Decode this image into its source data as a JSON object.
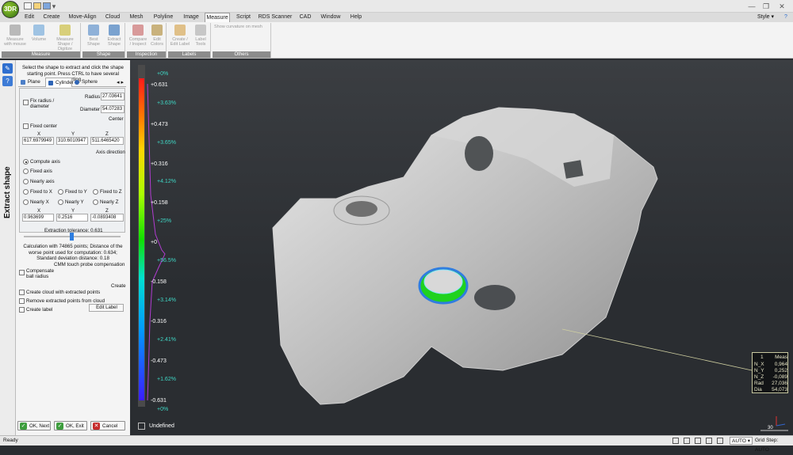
{
  "app": {
    "logo_text": "3DR"
  },
  "menu": {
    "items": [
      "Edit",
      "Create",
      "Move-Align",
      "Cloud",
      "Mesh",
      "Polyline",
      "Image",
      "Measure",
      "Script",
      "RDS Scanner",
      "CAD",
      "Window",
      "Help"
    ],
    "active": "Measure",
    "style_label": "Style"
  },
  "ribbon": {
    "groups": [
      {
        "label": "Measure",
        "buttons": [
          "Measure with mouse",
          "Volume",
          "Measure Shape / Digitize"
        ]
      },
      {
        "label": "Shape",
        "buttons": [
          "Best Shape",
          "Extract Shape"
        ]
      },
      {
        "label": "Inspection",
        "buttons": [
          "Compare / Inspect",
          "Edit Colors"
        ]
      },
      {
        "label": "Labels",
        "buttons": [
          "Create / Edit Label",
          "Label Tools"
        ]
      },
      {
        "label": "Others",
        "buttons": [
          "Show curvature on mesh"
        ]
      }
    ]
  },
  "panel": {
    "title": "Extract shape",
    "instructions": "Select the shape to extract and click the shape starting point. Press CTRL to have several starting",
    "tabs": [
      "Plane",
      "Cylinder",
      "Sphere"
    ],
    "active_tab": "Cylinder",
    "fix_radius_label": "Fix radius / diameter",
    "radius_label": "Radius",
    "radius_value": "27.03641",
    "diameter_label": "Diameter",
    "diameter_value": "54.07283",
    "center_label": "Center",
    "fixed_center_label": "Fixed center",
    "center_x_label": "X",
    "center_y_label": "Y",
    "center_z_label": "Z",
    "center_x": "617.6979949",
    "center_y": "310.6010947",
    "center_z": "511.6465420",
    "axis_direction_label": "Axis direction",
    "axis_options": [
      "Compute axis",
      "Fixed axis",
      "Nearly axis"
    ],
    "axis_selected": "Compute axis",
    "fixed_to": [
      "Fixed to X",
      "Fixed to Y",
      "Fixed to Z"
    ],
    "nearly": [
      "Nearly X",
      "Nearly Y",
      "Nearly Z"
    ],
    "axis_x_label": "X",
    "axis_y_label": "Y",
    "axis_z_label": "Z",
    "axis_x": "0.963699",
    "axis_y": "0.2516",
    "axis_z": "-0.0893408",
    "tolerance_label": "Extraction tolerance: 0.631",
    "calc_text": "Calculation with 74865 points; Distance of the worse point used for computation: 0.634; Standard deviation distance: 0.18",
    "cmm_label": "CMM touch probe compensation",
    "compensate_label": "Compensate ball radius",
    "create_label": "Create",
    "create_cloud_label": "Create cloud with extracted points",
    "remove_points_label": "Remove extracted points from cloud",
    "create_label_label": "Create label",
    "edit_label_button": "Edit Label",
    "ok_next": "OK, Next",
    "ok_exit": "OK, Exit",
    "cancel": "Cancel"
  },
  "colorbar": {
    "values": [
      "+0.631",
      "+0.473",
      "+0.316",
      "+0.158",
      "+0",
      "-0.158",
      "-0.316",
      "-0.473",
      "-0.631"
    ],
    "percents": [
      "+0%",
      "+3.63%",
      "+3.65%",
      "+4.12%",
      "+25%",
      "+56.5%",
      "+3.14%",
      "+2.41%",
      "+1.62%",
      "+0%"
    ],
    "undefined_label": "Undefined"
  },
  "measurement": {
    "header": "Meas",
    "rows": [
      {
        "key": "N_X",
        "value": "0,964"
      },
      {
        "key": "N_Y",
        "value": "0,252"
      },
      {
        "key": "N_Z",
        "value": "-0,089"
      },
      {
        "key": "Rad",
        "value": "27,036"
      },
      {
        "key": "Dia",
        "value": "54,073"
      }
    ]
  },
  "viewport": {
    "scale_label": "30"
  },
  "status": {
    "ready": "Ready",
    "auto": "AUTO",
    "grid_step": "Grid Step: AUTO"
  }
}
